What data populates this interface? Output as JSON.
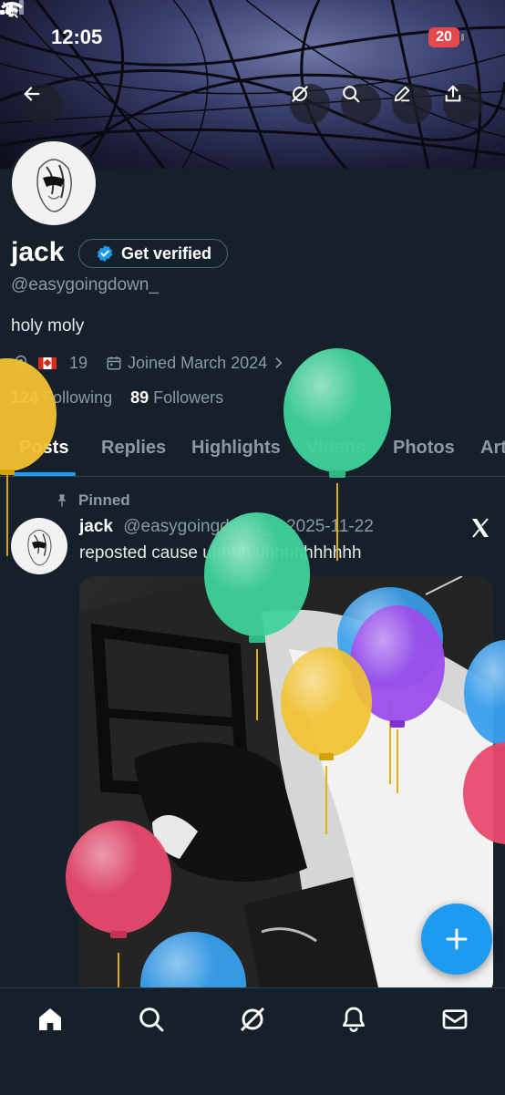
{
  "status_bar": {
    "time": "12:05",
    "battery": "20"
  },
  "profile": {
    "display_name": "jack",
    "get_verified_label": "Get verified",
    "handle": "@easygoingdown_",
    "bio": "holy moly",
    "location": "19",
    "joined": "Joined March 2024",
    "following_count": "124",
    "following_label": "Following",
    "followers_count": "89",
    "followers_label": "Followers"
  },
  "tabs": [
    {
      "label": "Posts"
    },
    {
      "label": "Replies"
    },
    {
      "label": "Highlights"
    },
    {
      "label": "Videos"
    },
    {
      "label": "Photos"
    },
    {
      "label": "Art"
    }
  ],
  "post": {
    "pinned_label": "Pinned",
    "author_name": "jack",
    "author_handle": "@easygoingdown_",
    "separator": "·",
    "date": "2025-11-22",
    "text": "reposted cause uhhhh uhhhhhhhhhh"
  },
  "icons": {
    "back": "arrow-left-icon",
    "grok": "grok-icon",
    "search": "search-icon",
    "edit": "edit-icon",
    "share": "share-icon",
    "verified": "verified-badge-icon",
    "location": "location-icon",
    "calendar": "calendar-icon",
    "chevron": "chevron-right-icon",
    "pin": "pin-icon",
    "x": "x-logo-icon",
    "compose": "plus-icon"
  },
  "colors": {
    "background": "#15202b",
    "accent": "#1d9bf0",
    "balloon_green": "#3fd39a",
    "balloon_yellow": "#f1c232",
    "balloon_purple": "#9b4dea",
    "balloon_blue": "#3aa0ee",
    "balloon_red": "#e84a6e"
  }
}
